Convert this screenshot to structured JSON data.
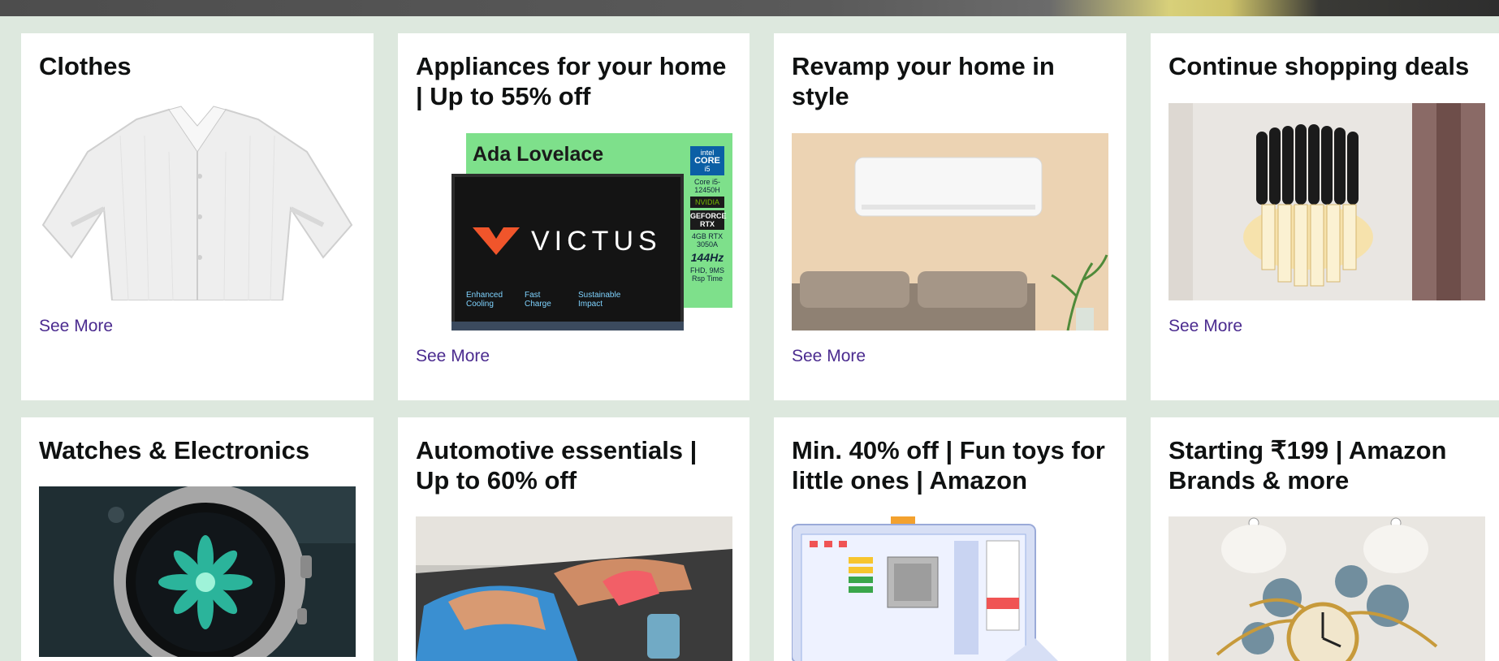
{
  "cards": [
    {
      "title": "Clothes",
      "image": "white-linen-shirt",
      "link": "See More"
    },
    {
      "title": "Appliances for your home | Up to 55% off",
      "image": "victus-laptop",
      "laptop": {
        "tag": "Ada Lovelace",
        "brand": "VICTUS",
        "specs": [
          "intel",
          "CORE",
          "i5",
          "Core i5-12450H",
          "NVIDIA",
          "GEFORCE RTX",
          "4GB RTX 3050A",
          "144Hz",
          "FHD, 9MS Rsp Time"
        ],
        "features": [
          "Enhanced Cooling",
          "Fast Charge",
          "Sustainable Impact"
        ]
      },
      "link": "See More"
    },
    {
      "title": "Revamp your home in style",
      "image": "air-conditioner-living-room",
      "link": "See More"
    },
    {
      "title": "Continue shopping deals",
      "image": "crystal-wall-lamp",
      "link": "See More"
    },
    {
      "title": "Watches & Electronics",
      "image": "smartwatch"
    },
    {
      "title": "Automotive essentials | Up to 60% off",
      "image": "car-cleaning"
    },
    {
      "title": "Min. 40% off | Fun toys for little ones | Amazon",
      "image": "kids-learning-laptop"
    },
    {
      "title": "Starting ₹199 | Amazon Brands & more",
      "image": "gold-wall-clock"
    }
  ],
  "colors": {
    "page_bg": "#dde8de",
    "card_bg": "#ffffff",
    "link": "#4b2b8f",
    "title": "#0f1111"
  }
}
